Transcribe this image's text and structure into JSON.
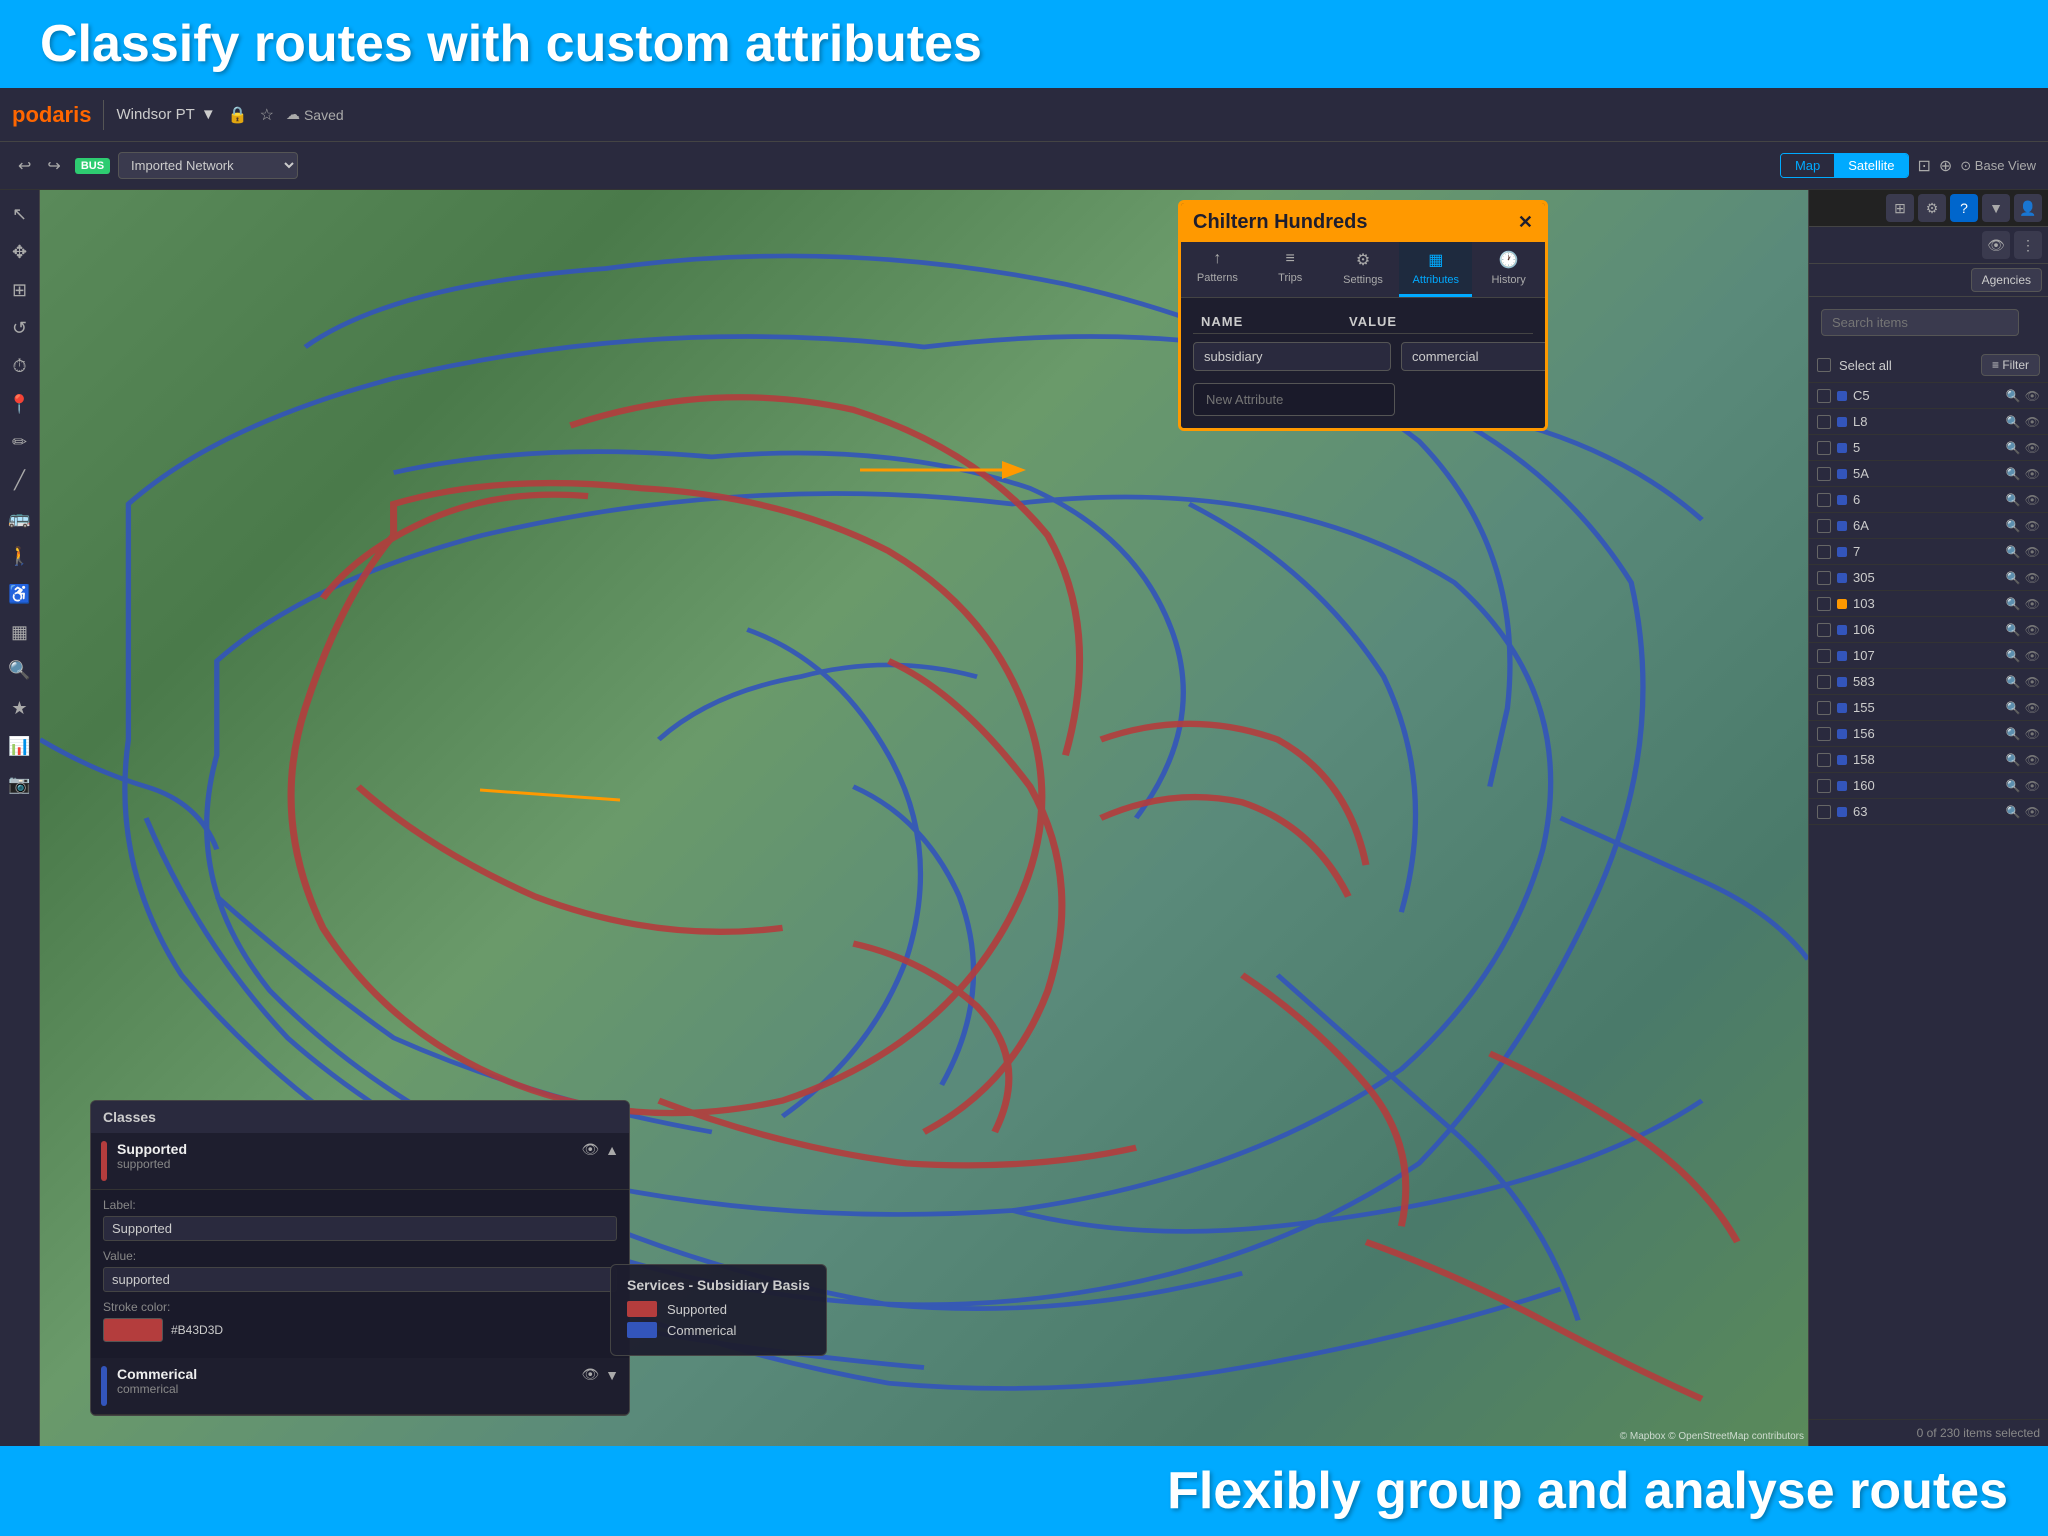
{
  "topBanner": {
    "text": "Classify routes with custom attributes"
  },
  "bottomBanner": {
    "text": "Flexibly group and analyse routes"
  },
  "toolbar": {
    "logoText": "podaris",
    "projectName": "Windsor PT",
    "savedText": "Saved",
    "undoLabel": "↩",
    "redoLabel": "↪",
    "busLabel": "BUS",
    "networkName": "Imported Network",
    "mapLabel": "Map",
    "satelliteLabel": "Satellite",
    "baseViewLabel": "⊙ Base View"
  },
  "chilternPanel": {
    "title": "Chiltern Hundreds",
    "closeLabel": "✕",
    "tabs": [
      {
        "id": "patterns",
        "label": "Patterns",
        "icon": "↑"
      },
      {
        "id": "trips",
        "label": "Trips",
        "icon": "≡"
      },
      {
        "id": "settings",
        "label": "Settings",
        "icon": "⚙"
      },
      {
        "id": "attributes",
        "label": "Attributes",
        "icon": "▦"
      },
      {
        "id": "history",
        "label": "History",
        "icon": "🕐"
      }
    ],
    "activeTab": "attributes",
    "attributes": {
      "nameHeader": "NAME",
      "valueHeader": "VALUE",
      "rows": [
        {
          "name": "subsidiary",
          "value": "commercial"
        }
      ],
      "newAttributePlaceholder": "New Attribute"
    }
  },
  "classesPanel": {
    "title": "Classes",
    "classes": [
      {
        "name": "Supported",
        "subtitle": "supported",
        "color": "#B43D3D",
        "expanded": true,
        "label": "Supported",
        "value": "supported",
        "strokeColor": "#B43D3D",
        "strokeColorHex": "#B43D3D"
      },
      {
        "name": "Commerical",
        "subtitle": "commerical",
        "color": "#3355BB",
        "expanded": false
      }
    ]
  },
  "legend": {
    "title": "Services - Subsidiary Basis",
    "items": [
      {
        "label": "Supported",
        "color": "#B43D3D"
      },
      {
        "label": "Commerical",
        "color": "#3355BB"
      }
    ]
  },
  "rightSidebar": {
    "searchPlaceholder": "Search items",
    "selectAllLabel": "Select all",
    "filterLabel": "≡ Filter",
    "routes": [
      {
        "name": "C5",
        "color": "#3355BB"
      },
      {
        "name": "L8",
        "color": "#3355BB"
      },
      {
        "name": "5",
        "color": "#3355BB"
      },
      {
        "name": "5A",
        "color": "#3355BB"
      },
      {
        "name": "6",
        "color": "#3355BB"
      },
      {
        "name": "6A",
        "color": "#3355BB"
      },
      {
        "name": "7",
        "color": "#3355BB"
      },
      {
        "name": "305",
        "color": "#3355BB"
      },
      {
        "name": "103",
        "color": "#ff9900"
      },
      {
        "name": "106",
        "color": "#3355BB"
      },
      {
        "name": "107",
        "color": "#3355BB"
      },
      {
        "name": "583",
        "color": "#3355BB"
      },
      {
        "name": "155",
        "color": "#3355BB"
      },
      {
        "name": "156",
        "color": "#3355BB"
      },
      {
        "name": "158",
        "color": "#3355BB"
      },
      {
        "name": "160",
        "color": "#3355BB"
      },
      {
        "name": "63",
        "color": "#3355BB"
      }
    ],
    "statusText": "0 of 230 items selected"
  },
  "mapCredit": "© Mapbox © OpenStreetMap contributors"
}
